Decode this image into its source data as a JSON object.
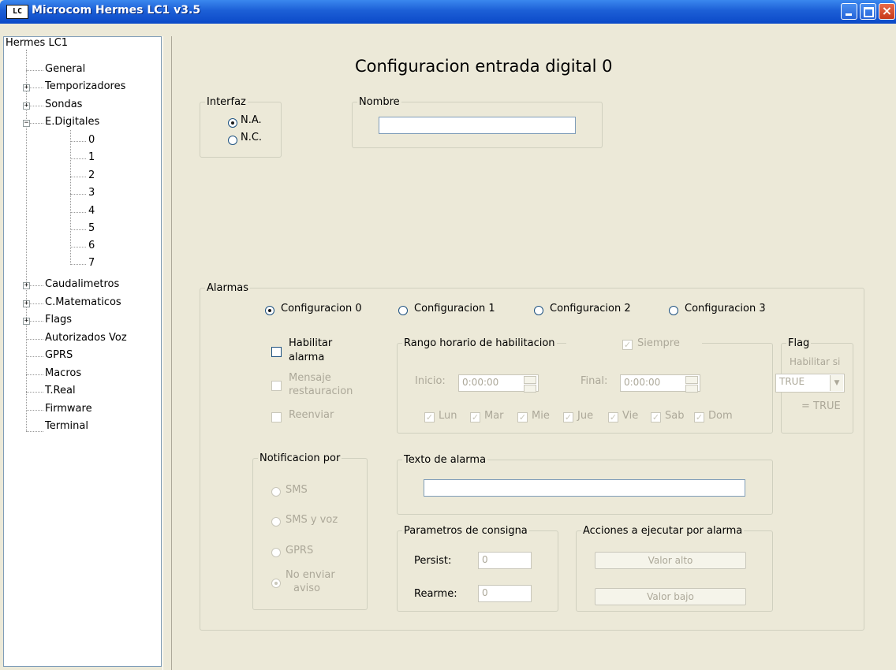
{
  "window": {
    "title": "Microcom Hermes LC1 v3.5",
    "app_icon_text": "LC"
  },
  "tree": {
    "root": "Hermes LC1",
    "items": [
      {
        "label": "General"
      },
      {
        "label": "Temporizadores",
        "expander": "+"
      },
      {
        "label": "Sondas",
        "expander": "+"
      },
      {
        "label": "E.Digitales",
        "expander": "−"
      },
      {
        "label": "Caudalimetros",
        "expander": "+"
      },
      {
        "label": "C.Matematicos",
        "expander": "+"
      },
      {
        "label": "Flags",
        "expander": "+"
      },
      {
        "label": "Autorizados Voz"
      },
      {
        "label": "GPRS"
      },
      {
        "label": "Macros"
      },
      {
        "label": "T.Real"
      },
      {
        "label": "Firmware"
      },
      {
        "label": "Terminal"
      }
    ],
    "digital_children": [
      "0",
      "1",
      "2",
      "3",
      "4",
      "5",
      "6",
      "7"
    ]
  },
  "main": {
    "title": "Configuracion entrada digital  0",
    "interfaz": {
      "legend": "Interfaz",
      "options": [
        "N.A.",
        "N.C."
      ],
      "selected": "N.A."
    },
    "nombre": {
      "legend": "Nombre",
      "value": ""
    },
    "alarmas": {
      "legend": "Alarmas",
      "configs": [
        "Configuracion 0",
        "Configuracion 1",
        "Configuracion 2",
        "Configuracion 3"
      ],
      "selected_config": "Configuracion 0",
      "habilitar_alarma": [
        "Habilitar",
        "alarma"
      ],
      "mensaje_restauracion": [
        "Mensaje",
        "restauracion"
      ],
      "reenviar": "Reenviar",
      "rango": {
        "legend": "Rango horario de habilitacion",
        "siempre": "Siempre",
        "inicio_label": "Inicio:",
        "inicio_value": "0:00:00",
        "final_label": "Final:",
        "final_value": "0:00:00",
        "days": [
          "Lun",
          "Mar",
          "Mie",
          "Jue",
          "Vie",
          "Sab",
          "Dom"
        ]
      },
      "flag": {
        "legend": "Flag",
        "habilitar_si": "Habilitar si",
        "value": "TRUE",
        "result": "= TRUE"
      },
      "notificacion": {
        "legend": "Notificacion por",
        "options": [
          "SMS",
          "SMS y voz",
          "GPRS"
        ],
        "no_enviar": [
          "No enviar",
          "aviso"
        ],
        "selected": "No enviar aviso"
      },
      "texto": {
        "legend": "Texto de alarma",
        "value": ""
      },
      "consigna": {
        "legend": "Parametros de consigna",
        "persist_label": "Persist:",
        "persist_value": "0",
        "rearme_label": "Rearme:",
        "rearme_value": "0"
      },
      "acciones": {
        "legend": "Acciones a ejecutar por alarma",
        "valor_alto": "Valor alto",
        "valor_bajo": "Valor bajo"
      }
    }
  },
  "colors": {
    "titlebar": "#0b49c8",
    "window_bg": "#ece9d8",
    "disabled_text": "#aca899",
    "check_green": "#21a121"
  }
}
